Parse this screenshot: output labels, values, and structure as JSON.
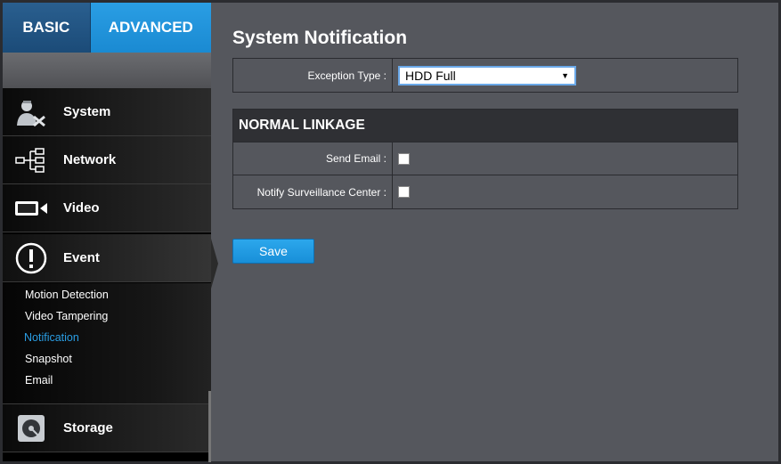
{
  "tabs": {
    "basic": "BASIC",
    "advanced": "ADVANCED"
  },
  "nav": {
    "system": "System",
    "network": "Network",
    "video": "Video",
    "event": "Event",
    "storage": "Storage"
  },
  "event_sub": [
    {
      "label": "Motion Detection"
    },
    {
      "label": "Video Tampering"
    },
    {
      "label": "Notification",
      "active": true
    },
    {
      "label": "Snapshot"
    },
    {
      "label": "Email"
    }
  ],
  "page": {
    "title": "System Notification",
    "exception_label": "Exception Type :",
    "exception_value": "HDD Full",
    "section_title": "NORMAL LINKAGE",
    "send_email_label": "Send Email :",
    "notify_center_label": "Notify Surveillance Center :",
    "save_label": "Save"
  },
  "colors": {
    "accent": "#1a8ad2",
    "active_link": "#2a9ee4",
    "background": "#55575d"
  }
}
